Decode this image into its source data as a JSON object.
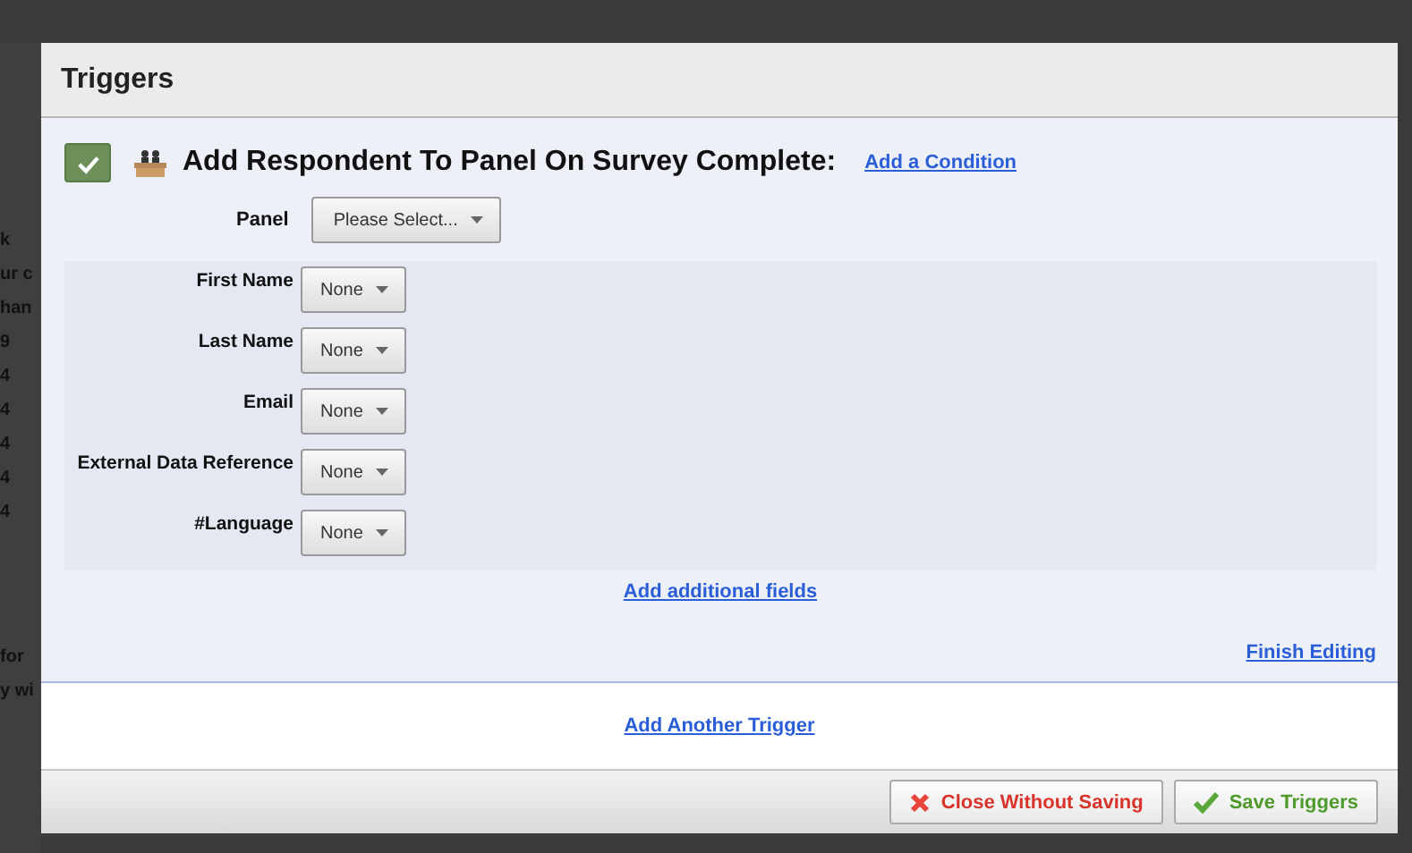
{
  "background_fragments": [
    "k",
    "ur c",
    "han",
    "9",
    "4",
    "4",
    "4",
    "4",
    "4",
    "for",
    "y wi"
  ],
  "window": {
    "title": "Triggers"
  },
  "trigger": {
    "checked": true,
    "title": "Add Respondent To Panel On Survey Complete:",
    "condition_link": "Add a Condition",
    "panel": {
      "label": "Panel",
      "value": "Please Select..."
    },
    "fields": [
      {
        "label": "First Name",
        "value": "None"
      },
      {
        "label": "Last Name",
        "value": "None"
      },
      {
        "label": "Email",
        "value": "None"
      },
      {
        "label": "External Data Reference",
        "value": "None"
      },
      {
        "label": "#Language",
        "value": "None"
      }
    ],
    "add_fields_link": "Add additional fields",
    "finish_link": "Finish Editing"
  },
  "add_trigger_link": "Add Another Trigger",
  "buttons": [
    {
      "kind": "cancel",
      "label": "Close Without Saving"
    },
    {
      "kind": "save",
      "label": "Save Triggers"
    }
  ]
}
